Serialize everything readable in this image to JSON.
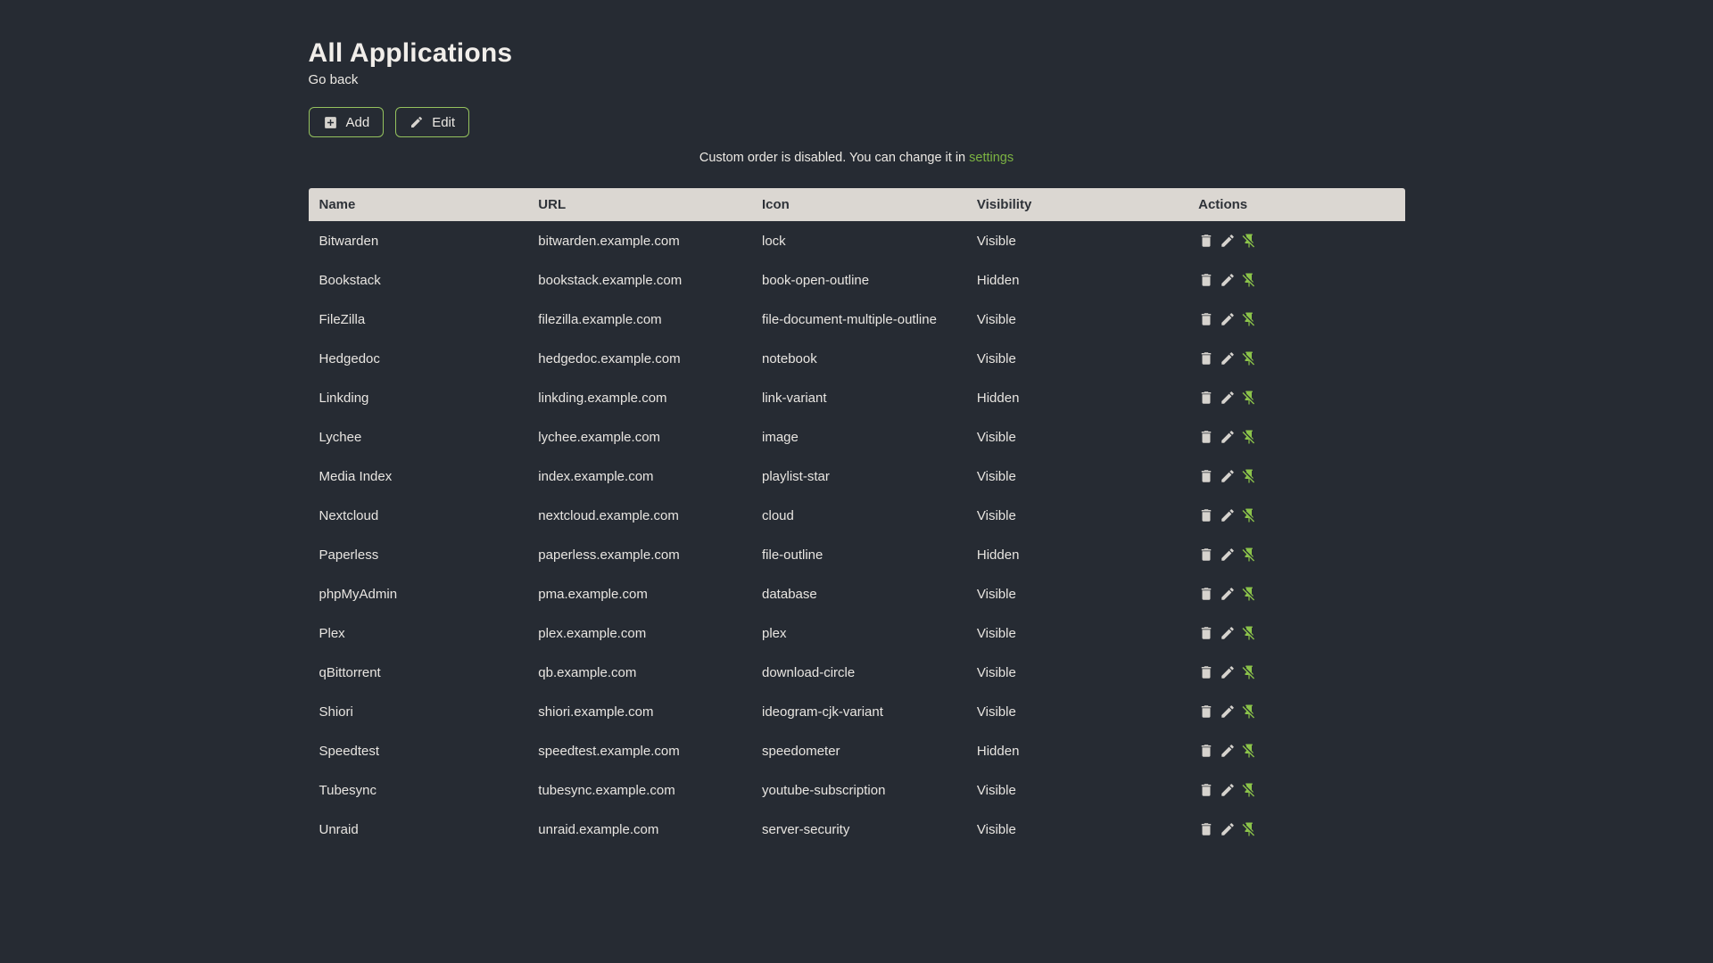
{
  "page": {
    "title": "All Applications",
    "back_label": "Go back"
  },
  "toolbar": {
    "add_label": "Add",
    "edit_label": "Edit"
  },
  "notice": {
    "text": "Custom order is disabled. You can change it in ",
    "link_label": "settings"
  },
  "table": {
    "columns": [
      "Name",
      "URL",
      "Icon",
      "Visibility",
      "Actions"
    ],
    "rows": [
      {
        "name": "Bitwarden",
        "url": "bitwarden.example.com",
        "icon": "lock",
        "visibility": "Visible"
      },
      {
        "name": "Bookstack",
        "url": "bookstack.example.com",
        "icon": "book-open-outline",
        "visibility": "Hidden"
      },
      {
        "name": "FileZilla",
        "url": "filezilla.example.com",
        "icon": "file-document-multiple-outline",
        "visibility": "Visible"
      },
      {
        "name": "Hedgedoc",
        "url": "hedgedoc.example.com",
        "icon": "notebook",
        "visibility": "Visible"
      },
      {
        "name": "Linkding",
        "url": "linkding.example.com",
        "icon": "link-variant",
        "visibility": "Hidden"
      },
      {
        "name": "Lychee",
        "url": "lychee.example.com",
        "icon": "image",
        "visibility": "Visible"
      },
      {
        "name": "Media Index",
        "url": "index.example.com",
        "icon": "playlist-star",
        "visibility": "Visible"
      },
      {
        "name": "Nextcloud",
        "url": "nextcloud.example.com",
        "icon": "cloud",
        "visibility": "Visible"
      },
      {
        "name": "Paperless",
        "url": "paperless.example.com",
        "icon": "file-outline",
        "visibility": "Hidden"
      },
      {
        "name": "phpMyAdmin",
        "url": "pma.example.com",
        "icon": "database",
        "visibility": "Visible"
      },
      {
        "name": "Plex",
        "url": "plex.example.com",
        "icon": "plex",
        "visibility": "Visible"
      },
      {
        "name": "qBittorrent",
        "url": "qb.example.com",
        "icon": "download-circle",
        "visibility": "Visible"
      },
      {
        "name": "Shiori",
        "url": "shiori.example.com",
        "icon": "ideogram-cjk-variant",
        "visibility": "Visible"
      },
      {
        "name": "Speedtest",
        "url": "speedtest.example.com",
        "icon": "speedometer",
        "visibility": "Hidden"
      },
      {
        "name": "Tubesync",
        "url": "tubesync.example.com",
        "icon": "youtube-subscription",
        "visibility": "Visible"
      },
      {
        "name": "Unraid",
        "url": "unraid.example.com",
        "icon": "server-security",
        "visibility": "Visible"
      }
    ],
    "row_action_icons": [
      "delete-icon",
      "pencil-icon",
      "pin-off-icon"
    ]
  },
  "colors": {
    "background": "#262b33",
    "accent_green": "#7cb342",
    "button_border_green": "#95c25e",
    "pin_icon_green": "#8bc34a",
    "table_header_bg": "#dbd7d2",
    "table_header_text": "#2e3238",
    "text_light": "#ece9e4",
    "icon_gray": "#d6d3ce"
  }
}
